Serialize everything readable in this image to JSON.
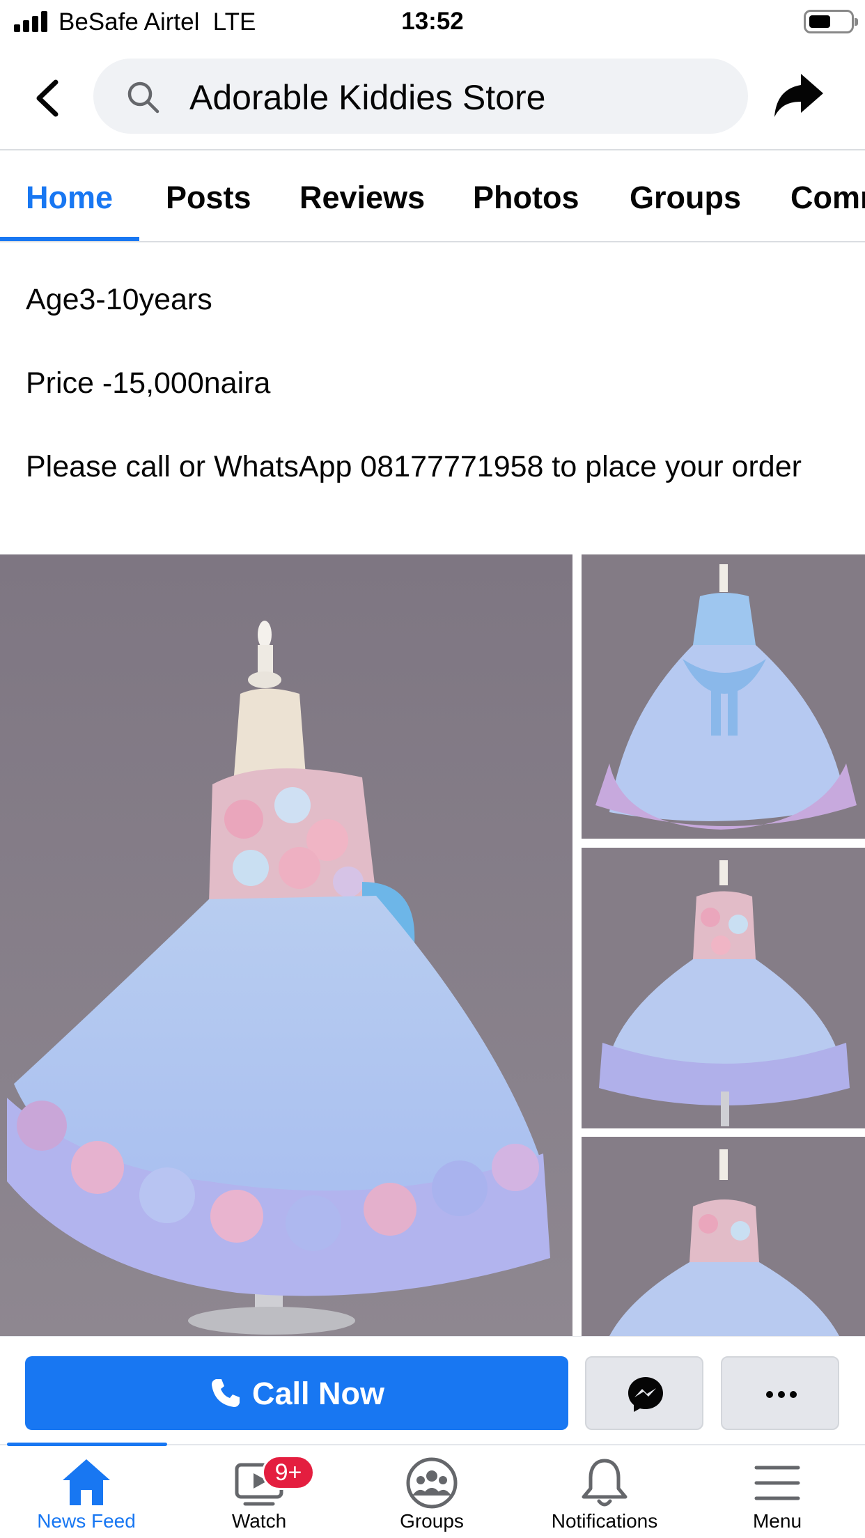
{
  "status_bar": {
    "carrier": "BeSafe Airtel  LTE",
    "time": "13:52"
  },
  "header": {
    "search_text": "Adorable Kiddies Store",
    "icons": [
      "back-arrow-icon",
      "search-icon",
      "share-icon"
    ]
  },
  "tabs": [
    {
      "label": "Home",
      "active": true
    },
    {
      "label": "Posts",
      "active": false
    },
    {
      "label": "Reviews",
      "active": false
    },
    {
      "label": "Photos",
      "active": false
    },
    {
      "label": "Groups",
      "active": false
    },
    {
      "label": "Comm",
      "active": false
    }
  ],
  "post": {
    "line_age": "Age3-10years",
    "line_price": "Price -15,000naira",
    "line_contact": "Please call or WhatsApp 08177771958 to place your order"
  },
  "action_bar": {
    "call_label": "Call Now",
    "accent_color": "#1877f2"
  },
  "bottom_nav": {
    "items": [
      {
        "label": "News Feed",
        "icon": "home-icon",
        "active": true
      },
      {
        "label": "Watch",
        "icon": "watch-icon",
        "badge": "9+"
      },
      {
        "label": "Groups",
        "icon": "groups-icon"
      },
      {
        "label": "Notifications",
        "icon": "bell-icon"
      },
      {
        "label": "Menu",
        "icon": "menu-icon"
      }
    ]
  }
}
